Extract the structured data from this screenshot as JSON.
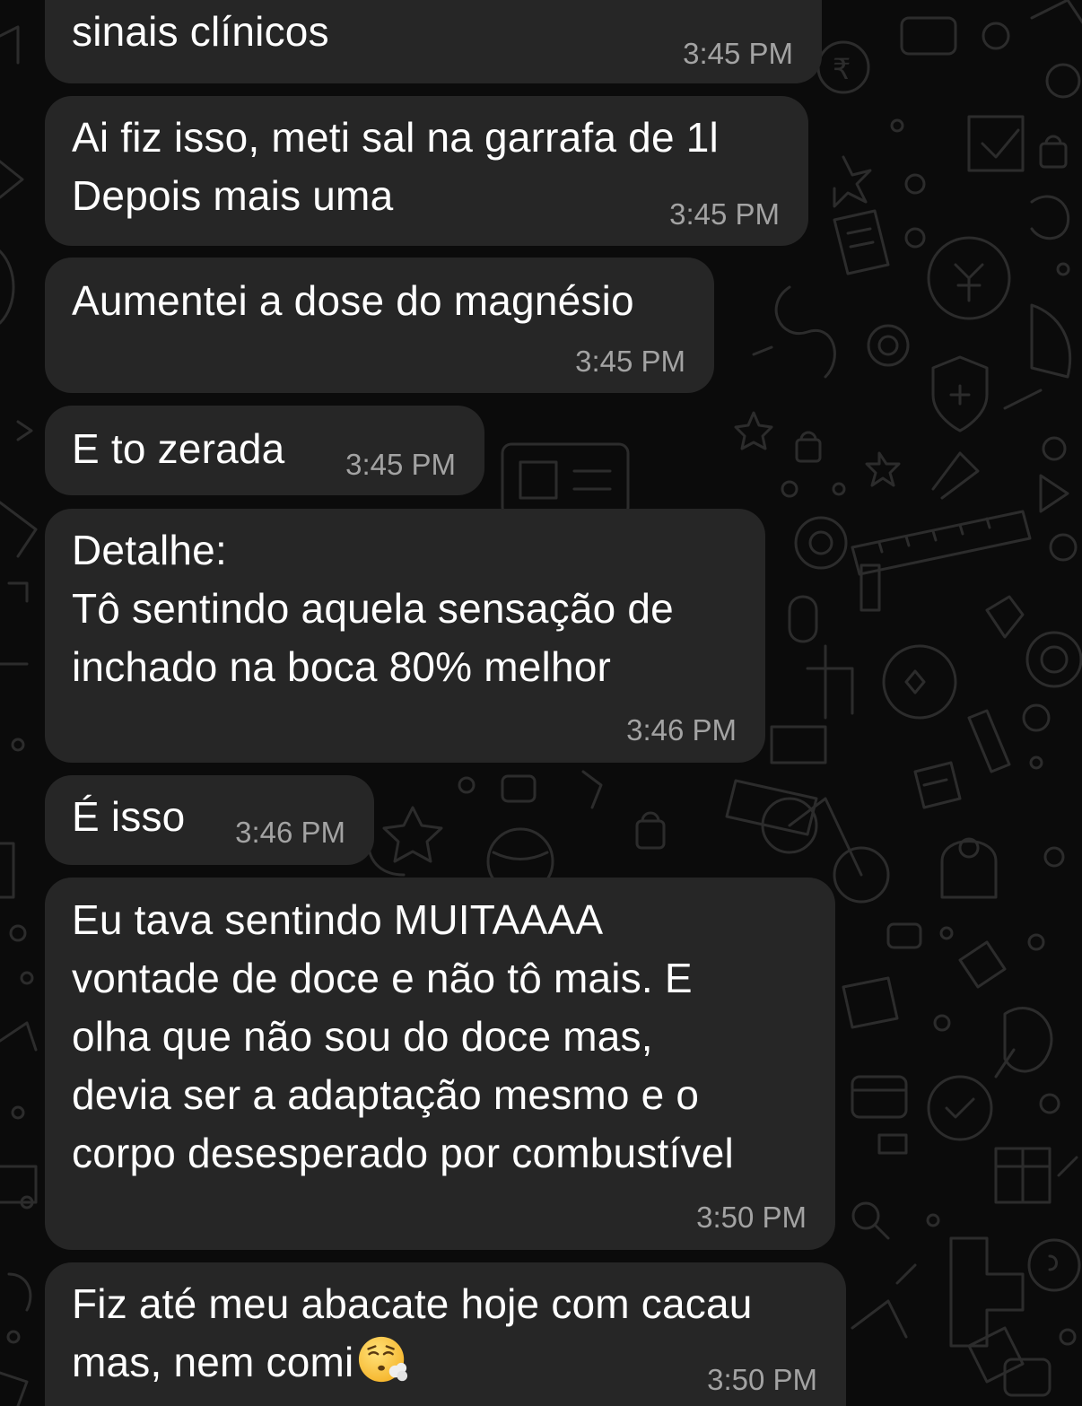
{
  "chat": {
    "messages": [
      {
        "text": "sinais clínicos",
        "time": "3:45 PM"
      },
      {
        "text": "Ai fiz isso, meti sal na garrafa de 1l\nDepois mais uma",
        "time": "3:45 PM"
      },
      {
        "text": "Aumentei a dose do magnésio",
        "time": "3:45 PM"
      },
      {
        "text": "E to zerada",
        "time": "3:45 PM"
      },
      {
        "text": "Detalhe:\nTô sentindo aquela sensação de\ninchado na boca 80% melhor",
        "time": "3:46 PM"
      },
      {
        "text": "É isso",
        "time": "3:46 PM"
      },
      {
        "text": "Eu tava sentindo MUITAAAA\nvontade de doce e não tô mais. E\nolha que não sou do doce mas,\ndevia ser a adaptação mesmo e o\ncorpo desesperado por combustível",
        "time": "3:50 PM"
      },
      {
        "text": "Fiz até meu abacate hoje com cacau\nmas, nem comi",
        "time": "3:50 PM",
        "emoji": "exhaling-face-emoji"
      }
    ]
  },
  "colors": {
    "background": "#0b0b0b",
    "bubble": "#262626",
    "text": "#ffffff",
    "timestamp": "#a3a3a3",
    "wallpaper_doodle": "#2e2e2e"
  }
}
